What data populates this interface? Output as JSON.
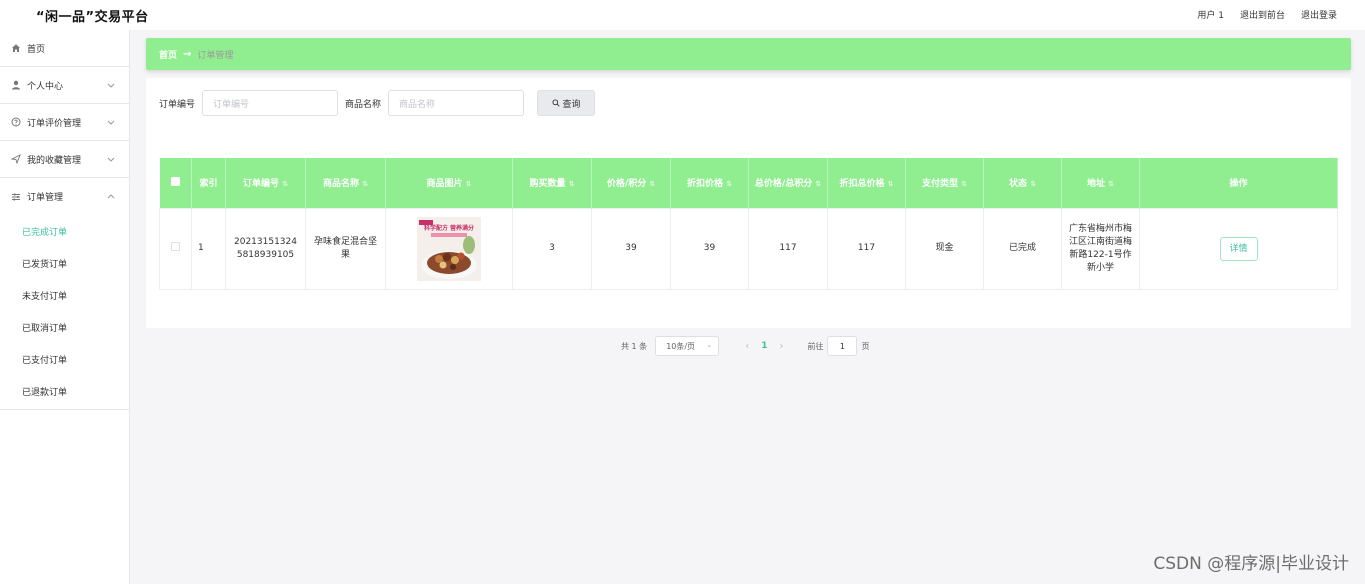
{
  "header": {
    "brand": "“闲一品”交易平台",
    "links": [
      "用户 1",
      "退出到前台",
      "退出登录"
    ]
  },
  "sidebar": {
    "items": [
      {
        "label": "首页",
        "icon": "home-icon",
        "expandable": false
      },
      {
        "label": "个人中心",
        "icon": "user-icon",
        "expandable": true
      },
      {
        "label": "订单评价管理",
        "icon": "help-circle-icon",
        "expandable": true
      },
      {
        "label": "我的收藏管理",
        "icon": "send-icon",
        "expandable": true
      },
      {
        "label": "订单管理",
        "icon": "sliders-icon",
        "expandable": true,
        "expanded": true
      }
    ],
    "order_submenu": [
      "已完成订单",
      "已发货订单",
      "未支付订单",
      "已取消订单",
      "已支付订单",
      "已退款订单"
    ],
    "active_sub": "已完成订单"
  },
  "breadcrumb": {
    "home": "首页",
    "separator": "→",
    "current": "订单管理"
  },
  "search": {
    "order_label": "订单编号",
    "order_placeholder": "订单编号",
    "product_label": "商品名称",
    "product_placeholder": "商品名称",
    "button": "查询"
  },
  "table": {
    "columns": [
      "",
      "索引",
      "订单编号",
      "商品名称",
      "商品图片",
      "购买数量",
      "价格/积分",
      "折扣价格",
      "总价格/总积分",
      "折扣总价格",
      "支付类型",
      "状态",
      "地址",
      "操作"
    ],
    "rows": [
      {
        "index": "1",
        "order_no": "202131513245818939105",
        "product_name": "孕味食足混合坚果",
        "image_text": "科学配方 营养满分",
        "quantity": "3",
        "price": "39",
        "discount_price": "39",
        "total_price": "117",
        "discount_total": "117",
        "pay_type": "现金",
        "status": "已完成",
        "address": "广东省梅州市梅江区江南街道梅新路122-1号作新小学",
        "action": "详情"
      }
    ]
  },
  "pagination": {
    "total": "共 1 条",
    "page_size": "10条/页",
    "current_page": "1",
    "goto_label": "前往",
    "goto_value": "1",
    "page_suffix": "页"
  },
  "watermark": "CSDN @程序源|毕业设计",
  "colors": {
    "accent_green": "#90ee90",
    "active_text": "#3bbfa0"
  }
}
